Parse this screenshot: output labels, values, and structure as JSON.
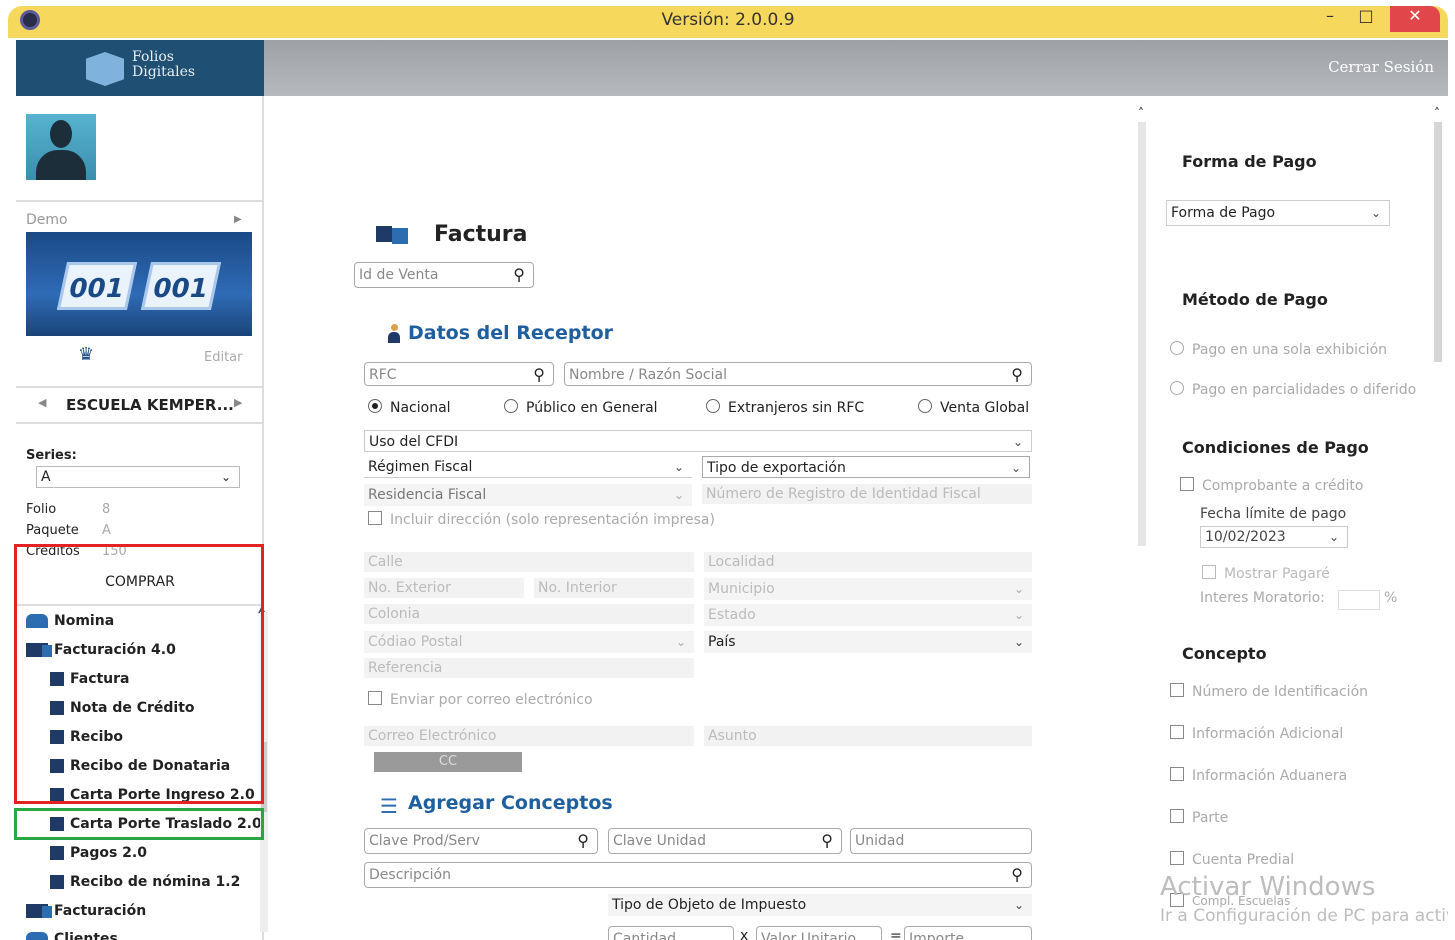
{
  "window": {
    "title": "Versión: 2.0.0.9",
    "minimize": "–",
    "maximize": "□",
    "close": "✕"
  },
  "brand": {
    "line1": "Folios",
    "line2": "Digitales"
  },
  "topbar": {
    "logout": "Cerrar Sesión"
  },
  "sidebar": {
    "demo_label": "Demo",
    "banner_tiles": [
      "001",
      "001"
    ],
    "edit_label": "Editar",
    "school": "ESCUELA KEMPER...",
    "series_label": "Series:",
    "series_value": "A",
    "folio_label": "Folio",
    "folio_value": "8",
    "paquete_label": "Paquete",
    "paquete_value": "A",
    "creditos_label": "Créditos",
    "creditos_value": "150",
    "buy_label": "COMPRAR",
    "menu": [
      {
        "label": "Nomina"
      },
      {
        "label": "Facturación 4.0"
      },
      {
        "label": "Factura"
      },
      {
        "label": "Nota de Crédito"
      },
      {
        "label": "Recibo"
      },
      {
        "label": "Recibo de Donataria"
      },
      {
        "label": "Carta Porte Ingreso 2.0"
      },
      {
        "label": "Carta Porte Traslado 2.0"
      },
      {
        "label": "Pagos 2.0"
      },
      {
        "label": "Recibo de nómina 1.2"
      },
      {
        "label": "Facturación"
      },
      {
        "label": "Clientes"
      }
    ]
  },
  "form": {
    "title": "Factura",
    "sale_id_placeholder": "Id de Venta",
    "receptor_header": "Datos del Receptor",
    "rfc_placeholder": "RFC",
    "name_placeholder": "Nombre  / Razón Social",
    "radios": [
      "Nacional",
      "Público en General",
      "Extranjeros sin RFC",
      "Venta Global"
    ],
    "uso_cfdi": "Uso del CFDI",
    "regimen": "Régimen Fiscal",
    "tipo_export": "Tipo de exportación",
    "residencia": "Residencia Fiscal",
    "num_registro": "Número de Registro de Identidad Fiscal",
    "incluir_dir": "Incluir dirección (solo representación impresa)",
    "calle": "Calle",
    "localidad": "Localidad",
    "no_ext": "No. Exterior",
    "no_int": "No. Interior",
    "municipio": "Municipio",
    "colonia": "Colonia",
    "estado": "Estado",
    "cp": "Códiao Postal",
    "pais": "País",
    "referencia": "Referencia",
    "enviar_correo": "Enviar por correo electrónico",
    "correo": "Correo Electrónico",
    "asunto": "Asunto",
    "cc": "CC",
    "conceptos_header": "Agregar Conceptos",
    "clave_prod": "Clave Prod/Serv",
    "clave_unidad": "Clave Unidad",
    "unidad": "Unidad",
    "descripcion": "Descripción",
    "tipo_objeto": "Tipo de Objeto de Impuesto",
    "cantidad": "Cantidad",
    "valor_unitario": "Valor Unitario",
    "importe": "Importe",
    "op_mult": "x",
    "op_eq": "="
  },
  "right": {
    "forma_pago_header": "Forma de Pago",
    "forma_pago_select": "Forma de Pago",
    "metodo_header": "Método de Pago",
    "metodo_opts": [
      "Pago en una sola exhibición",
      "Pago en parcialidades o diferido"
    ],
    "condiciones_header": "Condiciones de Pago",
    "credito": "Comprobante a crédito",
    "fecha_label": "Fecha límite de pago",
    "fecha_value": "10/02/2023",
    "mostrar_pagare": "Mostrar Pagaré",
    "interes": "Interes Moratorio:",
    "pct": "%",
    "concepto_header": "Concepto",
    "concepto_opts": [
      "Número de Identificación",
      "Información Adicional",
      "Información Aduanera",
      "Parte",
      "Cuenta Predial",
      "Compl. Escuelas"
    ]
  },
  "watermark": {
    "line1": "Activar Windows",
    "line2": "Ir a Configuración de PC para activ"
  }
}
